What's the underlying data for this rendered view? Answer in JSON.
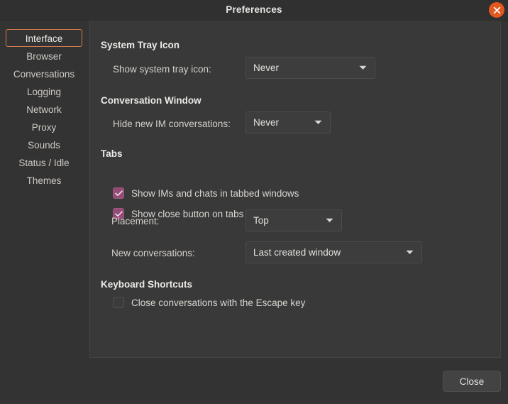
{
  "window": {
    "title": "Preferences",
    "close_icon": "close-circle-icon"
  },
  "colors": {
    "window_bg": "#333333",
    "panel_bg": "#393939",
    "titlebar_bg": "#303030",
    "accent_selected_border": "#d07a50",
    "checkbox_checked": "#944b76",
    "close_button": "#e2581f",
    "text": "#d6d2cd"
  },
  "sidebar": {
    "items": [
      {
        "label": "Interface",
        "selected": true
      },
      {
        "label": "Browser",
        "selected": false
      },
      {
        "label": "Conversations",
        "selected": false
      },
      {
        "label": "Logging",
        "selected": false
      },
      {
        "label": "Network",
        "selected": false
      },
      {
        "label": "Proxy",
        "selected": false
      },
      {
        "label": "Sounds",
        "selected": false
      },
      {
        "label": "Status / Idle",
        "selected": false
      },
      {
        "label": "Themes",
        "selected": false
      }
    ]
  },
  "main": {
    "sections": {
      "system_tray": {
        "heading": "System Tray Icon",
        "show_tray_label": "Show system tray icon:",
        "show_tray_value": "Never"
      },
      "conversation_window": {
        "heading": "Conversation Window",
        "hide_im_label": "Hide new IM conversations:",
        "hide_im_value": "Never"
      },
      "tabs": {
        "heading": "Tabs",
        "tabbed_windows_label": "Show IMs and chats in tabbed windows",
        "tabbed_windows_checked": true,
        "close_button_label": "Show close button on tabs",
        "close_button_checked": true,
        "placement_label": "Placement:",
        "placement_value": "Top",
        "new_conversations_label": "New conversations:",
        "new_conversations_value": "Last created window"
      },
      "keyboard_shortcuts": {
        "heading": "Keyboard Shortcuts",
        "escape_key_label": "Close conversations with the Escape key",
        "escape_key_checked": false
      }
    }
  },
  "footer": {
    "close_label": "Close"
  }
}
